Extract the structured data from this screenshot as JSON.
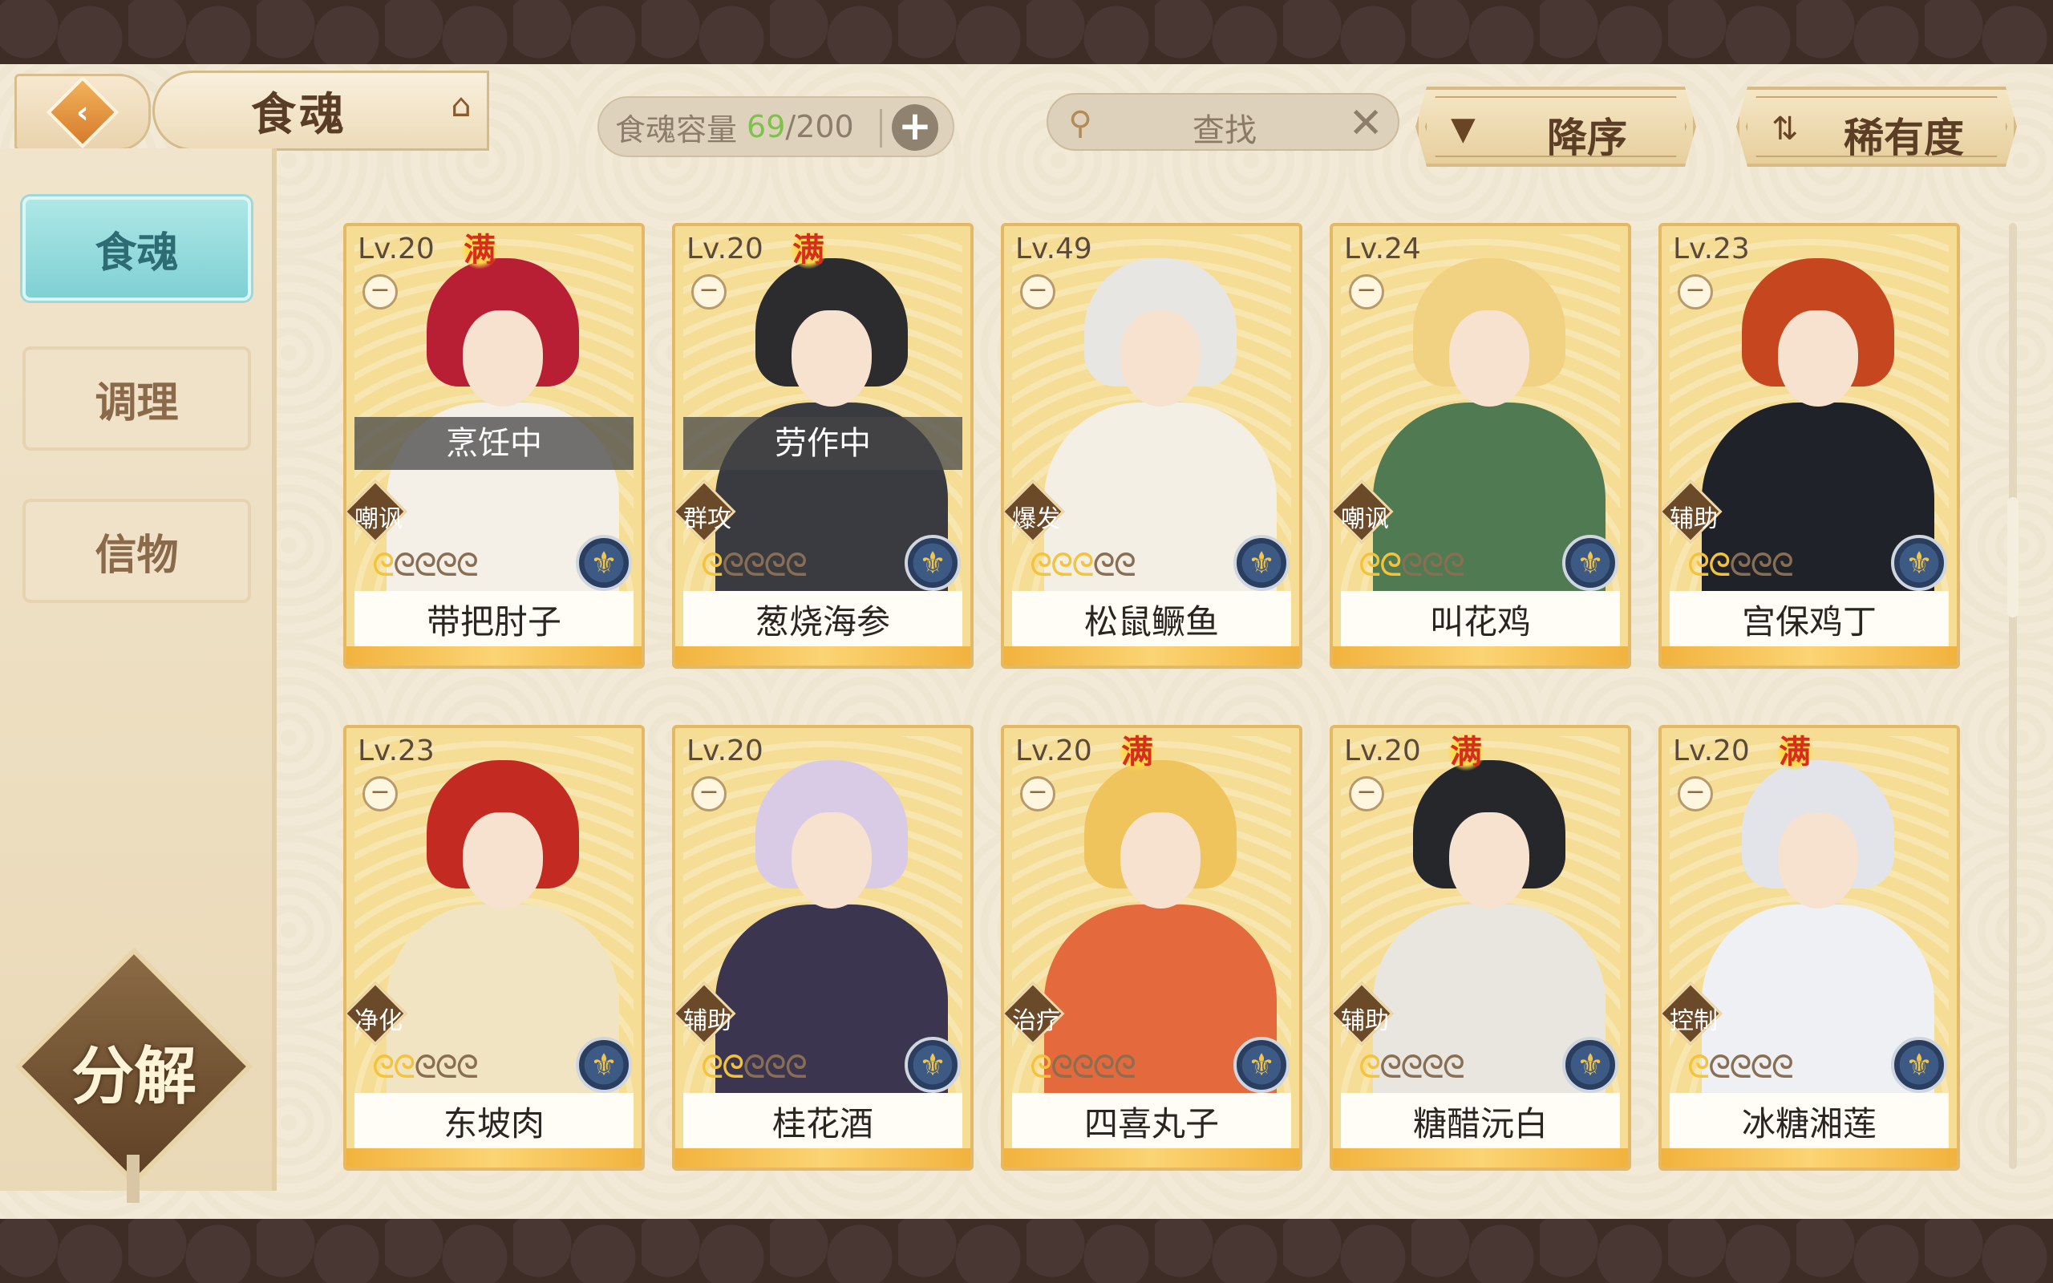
{
  "header": {
    "back_icon": "back-arrow-icon",
    "title": "食魂",
    "crown_icon": "pavilion-icon",
    "capacity_label": "食魂容量",
    "capacity_current": "69",
    "capacity_sep": "/",
    "capacity_max": "200",
    "capacity_plus": "+",
    "search_placeholder": "查找",
    "search_clear": "✕",
    "sort_order_label": "降序",
    "sort_field_label": "稀有度"
  },
  "sidebar": {
    "items": [
      {
        "label": "食魂",
        "active": true
      },
      {
        "label": "调理",
        "active": false
      },
      {
        "label": "信物",
        "active": false
      }
    ],
    "decompose_label": "分解"
  },
  "colors": {
    "accent_teal": "#7fd0d4",
    "capacity_green": "#7dc24a",
    "full_red": "#d72d1d",
    "card_gold": "#f3c969"
  },
  "cards": [
    {
      "level": "Lv.20",
      "full": "满",
      "status": "烹饪中",
      "role": "嘲讽",
      "stars_on": 1,
      "name": "带把肘子",
      "hair": "#b81f35",
      "outfit": "#f4efe7"
    },
    {
      "level": "Lv.20",
      "full": "满",
      "status": "劳作中",
      "role": "群攻",
      "stars_on": 1,
      "name": "葱烧海参",
      "hair": "#2c2b2d",
      "outfit": "#3a3b40"
    },
    {
      "level": "Lv.49",
      "full": "",
      "status": "",
      "role": "爆发",
      "stars_on": 3,
      "name": "松鼠鳜鱼",
      "hair": "#e8e6e3",
      "outfit": "#f3efe4"
    },
    {
      "level": "Lv.24",
      "full": "",
      "status": "",
      "role": "嘲讽",
      "stars_on": 2,
      "name": "叫花鸡",
      "hair": "#f1d283",
      "outfit": "#4f7a52"
    },
    {
      "level": "Lv.23",
      "full": "",
      "status": "",
      "role": "辅助",
      "stars_on": 2,
      "name": "宫保鸡丁",
      "hair": "#c6461f",
      "outfit": "#1f2329"
    },
    {
      "level": "Lv.23",
      "full": "",
      "status": "",
      "role": "净化",
      "stars_on": 2,
      "name": "东坡肉",
      "hair": "#c22a22",
      "outfit": "#f1e4c2"
    },
    {
      "level": "Lv.20",
      "full": "",
      "status": "",
      "role": "辅助",
      "stars_on": 2,
      "name": "桂花酒",
      "hair": "#d9cbe6",
      "outfit": "#3b3550"
    },
    {
      "level": "Lv.20",
      "full": "满",
      "status": "",
      "role": "治疗",
      "stars_on": 1,
      "name": "四喜丸子",
      "hair": "#f0c45c",
      "outfit": "#e46a3e"
    },
    {
      "level": "Lv.20",
      "full": "满",
      "status": "",
      "role": "辅助",
      "stars_on": 1,
      "name": "糖醋沅白",
      "hair": "#25272b",
      "outfit": "#e9e6e0"
    },
    {
      "level": "Lv.20",
      "full": "满",
      "status": "",
      "role": "控制",
      "stars_on": 1,
      "name": "冰糖湘莲",
      "hair": "#e2e4ea",
      "outfit": "#eef0f4"
    }
  ]
}
